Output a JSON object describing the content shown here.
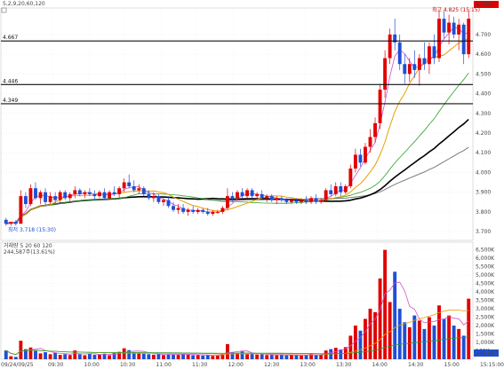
{
  "header": {
    "label": "5,2,9,20,60,120"
  },
  "price_panel": {
    "levels": [
      {
        "value": 4.667,
        "label": "4.667"
      },
      {
        "value": 4.446,
        "label": "4.446"
      },
      {
        "value": 4.349,
        "label": "4.349"
      }
    ],
    "last_price": "4.780",
    "high_label": "최고 4.825 (15:15)",
    "low_label": "최저 3.718 (15:30)"
  },
  "volume_panel": {
    "legend": "거래량 5 20 60 120",
    "current": "244,587주(13.61%)",
    "last_volume": "244,587"
  },
  "x_axis": {
    "date_label": "09/24/09/25",
    "ticks": [
      "09:30",
      "10:00",
      "10:30",
      "11:00",
      "11:30",
      "12:00",
      "12:30",
      "13:00",
      "13:30",
      "14:00",
      "14:30",
      "15:00",
      "15:15:00"
    ]
  },
  "colors": {
    "up": "#e00000",
    "down": "#1f4fd6",
    "ma5": "#d050d0",
    "ma20": "#e8a000",
    "ma60": "#2e9e2e",
    "ma120": "#000000",
    "ma240": "#7a7a7a"
  },
  "chart_data": [
    {
      "type": "candlestick",
      "y_ticks": [
        3.7,
        3.8,
        3.9,
        4.0,
        4.1,
        4.2,
        4.3,
        4.4,
        4.5,
        4.6,
        4.7
      ],
      "ylim": [
        3.66,
        4.83
      ],
      "candles": [
        [
          3.76,
          3.77,
          3.73,
          3.74
        ],
        [
          3.74,
          3.75,
          3.73,
          3.75
        ],
        [
          3.75,
          3.76,
          3.73,
          3.74
        ],
        [
          3.74,
          3.91,
          3.74,
          3.88
        ],
        [
          3.88,
          3.9,
          3.82,
          3.84
        ],
        [
          3.84,
          3.94,
          3.83,
          3.92
        ],
        [
          3.92,
          3.95,
          3.86,
          3.87
        ],
        [
          3.87,
          3.91,
          3.84,
          3.9
        ],
        [
          3.9,
          3.92,
          3.83,
          3.85
        ],
        [
          3.85,
          3.9,
          3.84,
          3.88
        ],
        [
          3.88,
          3.9,
          3.84,
          3.86
        ],
        [
          3.86,
          3.91,
          3.85,
          3.9
        ],
        [
          3.9,
          3.91,
          3.86,
          3.87
        ],
        [
          3.87,
          3.9,
          3.85,
          3.89
        ],
        [
          3.89,
          3.93,
          3.87,
          3.91
        ],
        [
          3.91,
          3.92,
          3.88,
          3.89
        ],
        [
          3.89,
          3.91,
          3.87,
          3.9
        ],
        [
          3.9,
          3.92,
          3.88,
          3.89
        ],
        [
          3.89,
          3.91,
          3.86,
          3.88
        ],
        [
          3.88,
          3.91,
          3.87,
          3.9
        ],
        [
          3.9,
          3.92,
          3.86,
          3.87
        ],
        [
          3.87,
          3.91,
          3.86,
          3.9
        ],
        [
          3.9,
          3.93,
          3.88,
          3.89
        ],
        [
          3.89,
          3.93,
          3.87,
          3.92
        ],
        [
          3.92,
          3.97,
          3.9,
          3.95
        ],
        [
          3.95,
          3.99,
          3.92,
          3.93
        ],
        [
          3.93,
          3.96,
          3.9,
          3.91
        ],
        [
          3.91,
          3.94,
          3.89,
          3.92
        ],
        [
          3.92,
          3.93,
          3.88,
          3.89
        ],
        [
          3.89,
          3.91,
          3.86,
          3.87
        ],
        [
          3.87,
          3.9,
          3.85,
          3.88
        ],
        [
          3.88,
          3.89,
          3.84,
          3.85
        ],
        [
          3.85,
          3.87,
          3.83,
          3.86
        ],
        [
          3.86,
          3.88,
          3.82,
          3.83
        ],
        [
          3.83,
          3.85,
          3.8,
          3.81
        ],
        [
          3.81,
          3.84,
          3.79,
          3.82
        ],
        [
          3.82,
          3.84,
          3.79,
          3.8
        ],
        [
          3.8,
          3.82,
          3.78,
          3.81
        ],
        [
          3.81,
          3.83,
          3.79,
          3.8
        ],
        [
          3.8,
          3.82,
          3.79,
          3.81
        ],
        [
          3.81,
          3.82,
          3.79,
          3.8
        ],
        [
          3.8,
          3.82,
          3.78,
          3.79
        ],
        [
          3.79,
          3.81,
          3.78,
          3.8
        ],
        [
          3.8,
          3.81,
          3.79,
          3.8
        ],
        [
          3.8,
          3.83,
          3.79,
          3.82
        ],
        [
          3.82,
          3.92,
          3.81,
          3.88
        ],
        [
          3.88,
          3.9,
          3.85,
          3.87
        ],
        [
          3.87,
          3.91,
          3.86,
          3.9
        ],
        [
          3.9,
          3.92,
          3.87,
          3.88
        ],
        [
          3.88,
          3.92,
          3.87,
          3.91
        ],
        [
          3.91,
          3.92,
          3.87,
          3.88
        ],
        [
          3.88,
          3.9,
          3.86,
          3.89
        ],
        [
          3.89,
          3.91,
          3.86,
          3.87
        ],
        [
          3.87,
          3.89,
          3.85,
          3.88
        ],
        [
          3.88,
          3.89,
          3.85,
          3.86
        ],
        [
          3.86,
          3.88,
          3.84,
          3.87
        ],
        [
          3.87,
          3.88,
          3.85,
          3.86
        ],
        [
          3.86,
          3.87,
          3.84,
          3.85
        ],
        [
          3.85,
          3.87,
          3.84,
          3.86
        ],
        [
          3.86,
          3.87,
          3.84,
          3.85
        ],
        [
          3.85,
          3.87,
          3.84,
          3.86
        ],
        [
          3.86,
          3.88,
          3.84,
          3.85
        ],
        [
          3.85,
          3.88,
          3.84,
          3.87
        ],
        [
          3.87,
          3.89,
          3.84,
          3.85
        ],
        [
          3.85,
          3.87,
          3.84,
          3.86
        ],
        [
          3.86,
          3.92,
          3.85,
          3.91
        ],
        [
          3.91,
          3.94,
          3.88,
          3.89
        ],
        [
          3.89,
          3.95,
          3.88,
          3.93
        ],
        [
          3.93,
          3.95,
          3.88,
          3.9
        ],
        [
          3.9,
          3.94,
          3.89,
          3.93
        ],
        [
          3.93,
          4.04,
          3.92,
          4.02
        ],
        [
          4.02,
          4.12,
          4.0,
          4.09
        ],
        [
          4.09,
          4.12,
          4.03,
          4.05
        ],
        [
          4.05,
          4.15,
          4.04,
          4.13
        ],
        [
          4.13,
          4.22,
          4.1,
          4.18
        ],
        [
          4.18,
          4.28,
          4.15,
          4.25
        ],
        [
          4.25,
          4.45,
          4.22,
          4.42
        ],
        [
          4.42,
          4.62,
          4.38,
          4.58
        ],
        [
          4.58,
          4.73,
          4.55,
          4.7
        ],
        [
          4.7,
          4.78,
          4.62,
          4.66
        ],
        [
          4.66,
          4.7,
          4.52,
          4.55
        ],
        [
          4.55,
          4.6,
          4.45,
          4.5
        ],
        [
          4.5,
          4.58,
          4.46,
          4.55
        ],
        [
          4.55,
          4.62,
          4.48,
          4.52
        ],
        [
          4.52,
          4.6,
          4.44,
          4.58
        ],
        [
          4.58,
          4.66,
          4.52,
          4.55
        ],
        [
          4.55,
          4.66,
          4.5,
          4.64
        ],
        [
          4.64,
          4.7,
          4.55,
          4.58
        ],
        [
          4.58,
          4.82,
          4.56,
          4.78
        ],
        [
          4.78,
          4.82,
          4.68,
          4.71
        ],
        [
          4.71,
          4.8,
          4.65,
          4.76
        ],
        [
          4.76,
          4.79,
          4.68,
          4.7
        ],
        [
          4.7,
          4.78,
          4.62,
          4.75
        ],
        [
          4.75,
          4.76,
          4.55,
          4.6
        ],
        [
          4.6,
          4.82,
          4.58,
          4.78
        ]
      ]
    },
    {
      "type": "bar",
      "y_tick_labels": [
        "500K",
        "1,000K",
        "1,500K",
        "2,000K",
        "2,500K",
        "3,000K",
        "3,500K",
        "4,000K",
        "4,500K",
        "5,000K",
        "5,500K",
        "6,000K",
        "6,500K"
      ],
      "y_tick_values": [
        500,
        1000,
        1500,
        2000,
        2500,
        3000,
        3500,
        4000,
        4500,
        5000,
        5500,
        6000,
        6500
      ],
      "ylim": [
        0,
        6800
      ],
      "unit": "K",
      "values": [
        520,
        180,
        140,
        1100,
        600,
        700,
        500,
        350,
        420,
        300,
        380,
        260,
        300,
        250,
        520,
        300,
        240,
        320,
        260,
        280,
        330,
        240,
        360,
        440,
        650,
        540,
        420,
        380,
        330,
        300,
        270,
        310,
        250,
        300,
        290,
        260,
        320,
        280,
        240,
        250,
        220,
        260,
        200,
        230,
        300,
        900,
        420,
        380,
        460,
        300,
        330,
        280,
        300,
        250,
        260,
        240,
        280,
        230,
        260,
        240,
        220,
        260,
        300,
        240,
        260,
        520,
        600,
        680,
        580,
        720,
        1400,
        2000,
        1700,
        2400,
        3000,
        2800,
        4800,
        6500,
        3400,
        5200,
        3000,
        2200,
        1900,
        2600,
        2300,
        1800,
        2500,
        2000,
        3200,
        2400,
        2600,
        2000,
        1800,
        1400,
        3600
      ]
    }
  ]
}
